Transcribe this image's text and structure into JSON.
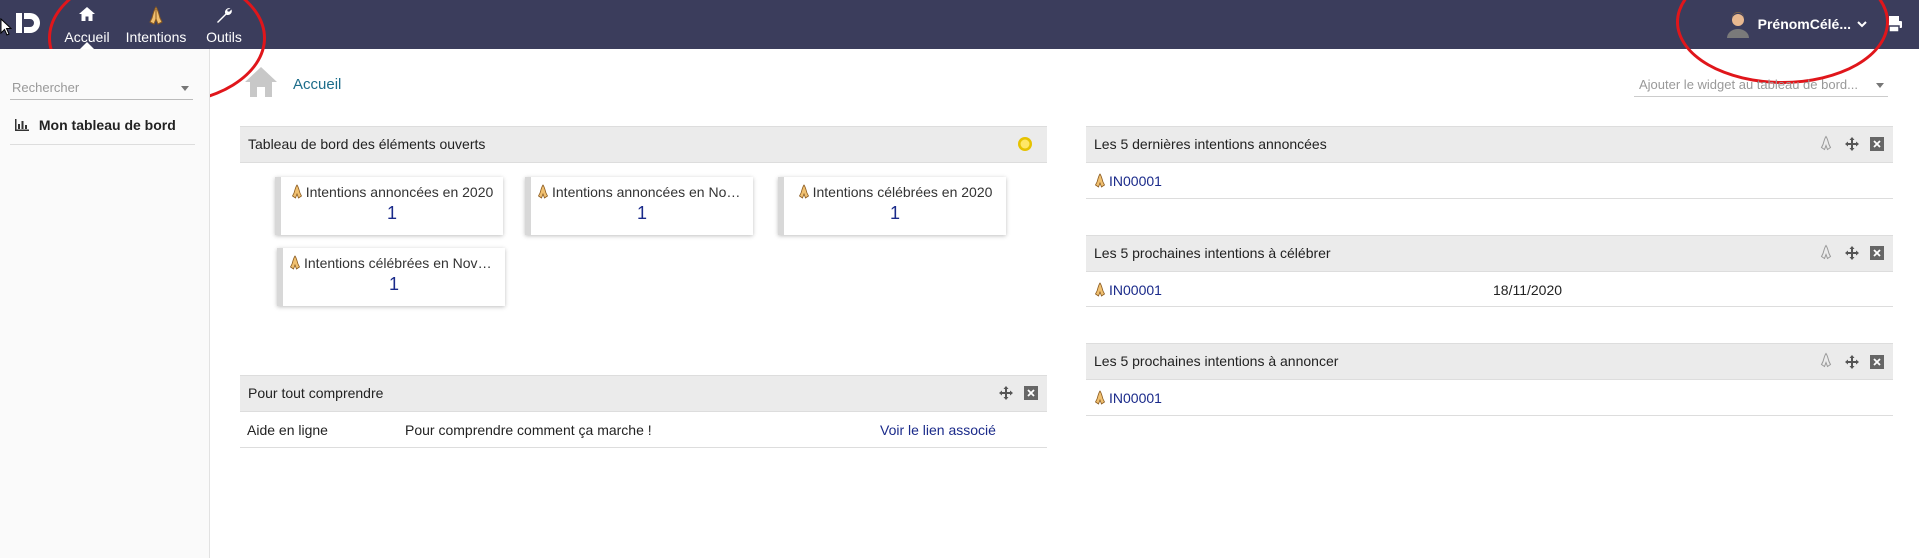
{
  "topbar": {
    "nav": [
      {
        "label": "Accueil",
        "icon": "home-icon"
      },
      {
        "label": "Intentions",
        "icon": "praying-hands-icon"
      },
      {
        "label": "Outils",
        "icon": "wrench-icon"
      }
    ],
    "user_name": "PrénomCélé...",
    "colors": {
      "bar": "#3b3d5c",
      "annotation": "#e0161b"
    }
  },
  "sidebar": {
    "search_placeholder": "Rechercher",
    "items": [
      {
        "label": "Mon tableau de bord",
        "icon": "bar-chart-icon"
      }
    ]
  },
  "breadcrumb": {
    "label": "Accueil"
  },
  "add_widget": {
    "placeholder": "Ajouter le widget au tableau de bord..."
  },
  "open_elements": {
    "title": "Tableau de bord des éléments ouverts",
    "cards": [
      {
        "label": "Intentions annoncées en 2020",
        "value": "1"
      },
      {
        "label": "Intentions annoncées en Nove...",
        "value": "1"
      },
      {
        "label": "Intentions célébrées en 2020",
        "value": "1"
      },
      {
        "label": "Intentions célébrées en Novem...",
        "value": "1"
      }
    ]
  },
  "help": {
    "title": "Pour tout comprendre",
    "row": {
      "name": "Aide en ligne",
      "description": "Pour comprendre comment ça marche !",
      "link": "Voir le lien associé"
    }
  },
  "last_announced": {
    "title": "Les 5 dernières intentions annoncées",
    "rows": [
      {
        "id": "IN00001"
      }
    ]
  },
  "next_celebrate": {
    "title": "Les 5 prochaines intentions à célébrer",
    "rows": [
      {
        "id": "IN00001",
        "date": "18/11/2020"
      }
    ]
  },
  "next_announce": {
    "title": "Les 5 prochaines intentions à annoncer",
    "rows": [
      {
        "id": "IN00001"
      }
    ]
  }
}
